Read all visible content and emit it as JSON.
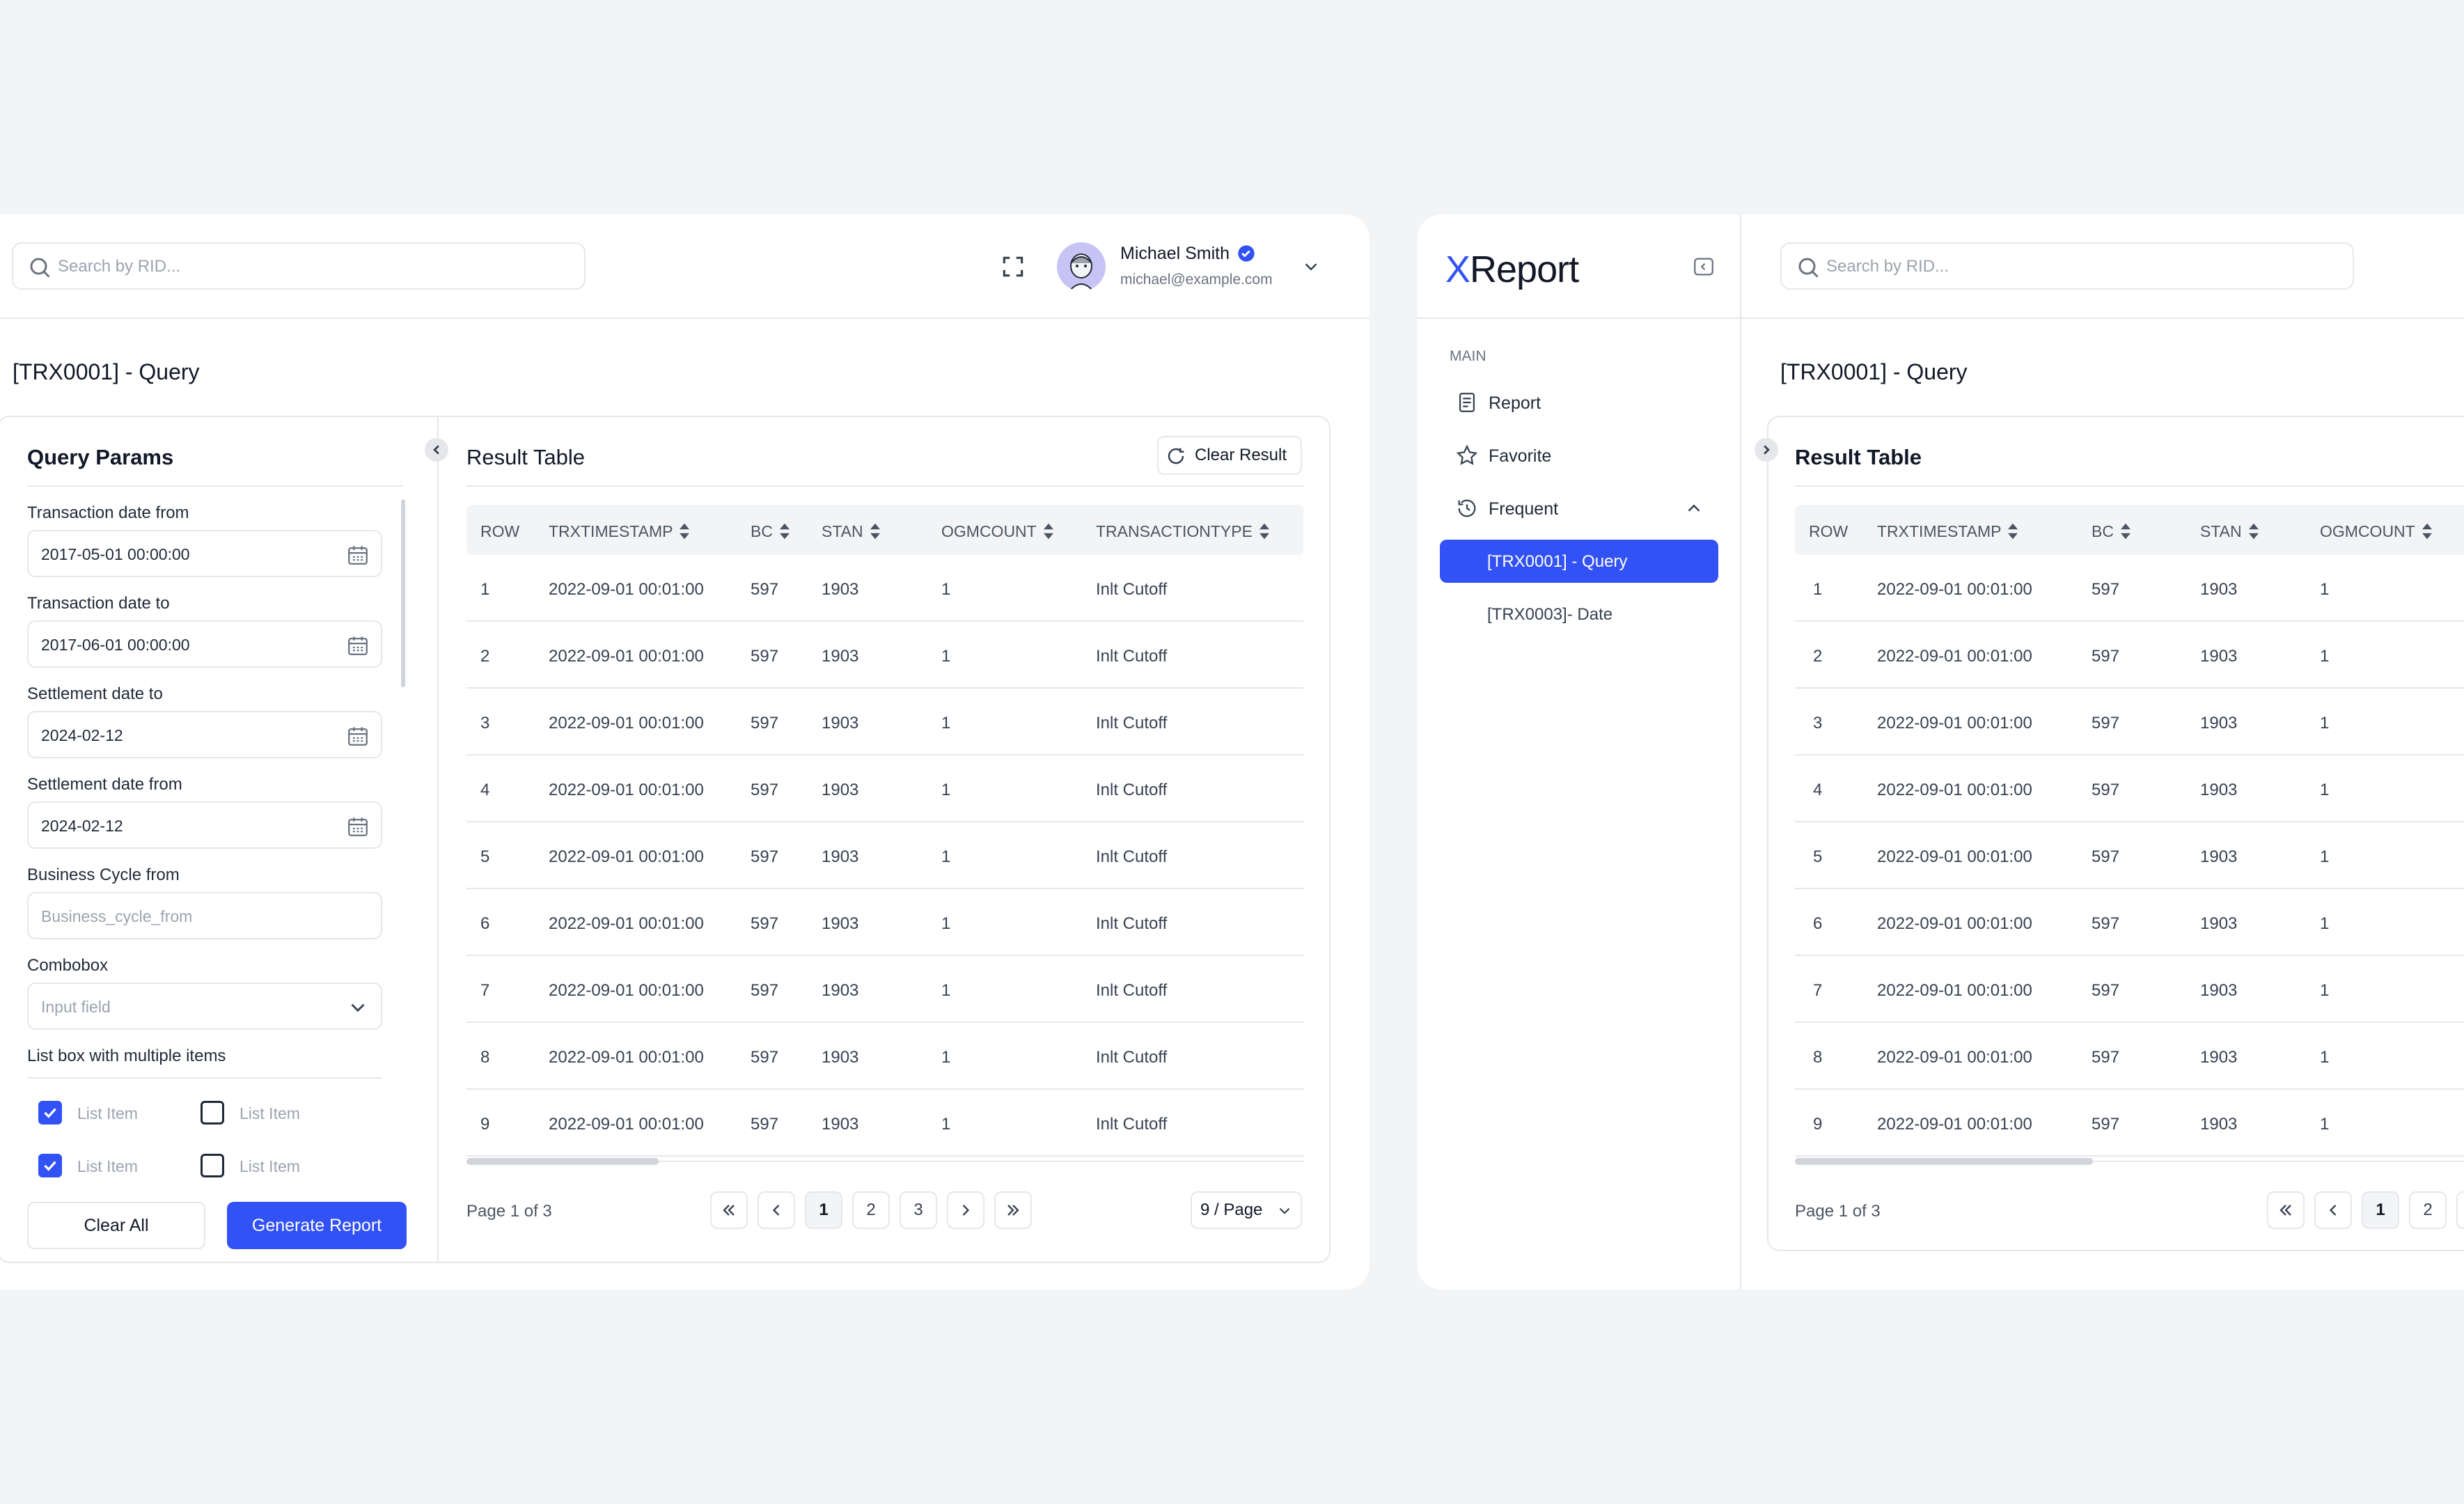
{
  "search": {
    "placeholder": "Search by RID..."
  },
  "user": {
    "name": "Michael Smith",
    "email": "michael@example.com"
  },
  "page_title": "[TRX0001] - Query",
  "query_params": {
    "title": "Query Params",
    "fields": [
      {
        "label": "Transaction date from",
        "value": "2017-05-01 00:00:00"
      },
      {
        "label": "Transaction date to",
        "value": "2017-06-01 00:00:00"
      },
      {
        "label": "Settlement date to",
        "value": "2024-02-12"
      },
      {
        "label": "Settlement date from",
        "value": "2024-02-12"
      }
    ],
    "business_cycle": {
      "label": "Business Cycle from",
      "placeholder": "Business_cycle_from"
    },
    "combobox": {
      "label": "Combobox",
      "placeholder": "Input field"
    },
    "listbox": {
      "label": "List box with multiple items",
      "items": [
        {
          "label": "List Item",
          "checked": true
        },
        {
          "label": "List Item",
          "checked": false
        },
        {
          "label": "List Item",
          "checked": true
        },
        {
          "label": "List Item",
          "checked": false
        }
      ]
    },
    "clear_label": "Clear All",
    "generate_label": "Generate Report"
  },
  "result": {
    "title": "Result Table",
    "clear_label": "Clear Result",
    "columns": [
      "ROW",
      "TRXTIMESTAMP",
      "BC",
      "STAN",
      "OGMCOUNT",
      "TRANSACTIONTYPE"
    ],
    "rows": [
      [
        "1",
        "2022-09-01 00:01:00",
        "597",
        "1903",
        "1",
        "Inlt Cutoff"
      ],
      [
        "2",
        "2022-09-01 00:01:00",
        "597",
        "1903",
        "1",
        "Inlt Cutoff"
      ],
      [
        "3",
        "2022-09-01 00:01:00",
        "597",
        "1903",
        "1",
        "Inlt Cutoff"
      ],
      [
        "4",
        "2022-09-01 00:01:00",
        "597",
        "1903",
        "1",
        "Inlt Cutoff"
      ],
      [
        "5",
        "2022-09-01 00:01:00",
        "597",
        "1903",
        "1",
        "Inlt Cutoff"
      ],
      [
        "6",
        "2022-09-01 00:01:00",
        "597",
        "1903",
        "1",
        "Inlt Cutoff"
      ],
      [
        "7",
        "2022-09-01 00:01:00",
        "597",
        "1903",
        "1",
        "Inlt Cutoff"
      ],
      [
        "8",
        "2022-09-01 00:01:00",
        "597",
        "1903",
        "1",
        "Inlt Cutoff"
      ],
      [
        "9",
        "2022-09-01 00:01:00",
        "597",
        "1903",
        "1",
        "Inlt Cutoff"
      ]
    ],
    "page_info": "Page 1 of 3",
    "pages": [
      "1",
      "2",
      "3"
    ],
    "per_page": "9 / Page"
  },
  "sidebar": {
    "logo_x": "X",
    "logo_rest": "Report",
    "section": "MAIN",
    "items": [
      {
        "label": "Report",
        "icon": "document-icon"
      },
      {
        "label": "Favorite",
        "icon": "star-icon"
      },
      {
        "label": "Frequent",
        "icon": "history-icon"
      }
    ],
    "sub_items": [
      {
        "label": "[TRX0001] - Query",
        "active": true
      },
      {
        "label": "[TRX0003]- Date",
        "active": false
      }
    ]
  },
  "colors": {
    "accent": "#3352f5",
    "border": "#e5e7eb",
    "background": "#f3f4f6"
  }
}
